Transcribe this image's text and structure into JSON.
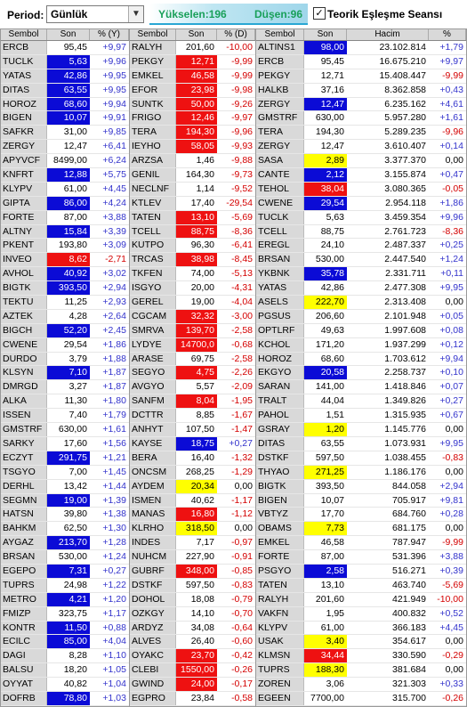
{
  "toolbar": {
    "period_label": "Period:",
    "period_value": "Günlük",
    "advancers": "Yükselen:196",
    "decliners": "Düşen:96",
    "theoretical_label": "Teorik Eşleşme Seansı",
    "theoretical_checked": true
  },
  "colors": {
    "highlight_blue": "#0b0bd6",
    "highlight_red": "#ee1111",
    "highlight_yellow": "#ffff00",
    "positive": "#3333cc",
    "negative": "#d40000"
  },
  "panel1": {
    "headers": [
      "Sembol",
      "Son",
      "% (Y)"
    ],
    "rows": [
      [
        "ERCB",
        "95,45",
        "+9,97",
        ""
      ],
      [
        "TUCLK",
        "5,63",
        "+9,96",
        "blue"
      ],
      [
        "YATAS",
        "42,86",
        "+9,95",
        "blue"
      ],
      [
        "DITAS",
        "63,55",
        "+9,95",
        "blue"
      ],
      [
        "HOROZ",
        "68,60",
        "+9,94",
        "blue"
      ],
      [
        "BIGEN",
        "10,07",
        "+9,91",
        "blue"
      ],
      [
        "SAFKR",
        "31,00",
        "+9,85",
        ""
      ],
      [
        "ZERGY",
        "12,47",
        "+6,41",
        ""
      ],
      [
        "APYVCF",
        "8499,00",
        "+6,24",
        ""
      ],
      [
        "KNFRT",
        "12,88",
        "+5,75",
        "blue"
      ],
      [
        "KLYPV",
        "61,00",
        "+4,45",
        ""
      ],
      [
        "GIPTA",
        "86,00",
        "+4,24",
        "blue"
      ],
      [
        "FORTE",
        "87,00",
        "+3,88",
        ""
      ],
      [
        "ALTNY",
        "15,84",
        "+3,39",
        "blue"
      ],
      [
        "PKENT",
        "193,80",
        "+3,09",
        ""
      ],
      [
        "INVEO",
        "8,62",
        "-2,71",
        "red"
      ],
      [
        "AVHOL",
        "40,92",
        "+3,02",
        "blue"
      ],
      [
        "BIGTK",
        "393,50",
        "+2,94",
        "blue"
      ],
      [
        "TEKTU",
        "11,25",
        "+2,93",
        ""
      ],
      [
        "AZTEK",
        "4,28",
        "+2,64",
        ""
      ],
      [
        "BIGCH",
        "52,20",
        "+2,45",
        "blue"
      ],
      [
        "CWENE",
        "29,54",
        "+1,86",
        ""
      ],
      [
        "DURDO",
        "3,79",
        "+1,88",
        ""
      ],
      [
        "KLSYN",
        "7,10",
        "+1,87",
        "blue"
      ],
      [
        "DMRGD",
        "3,27",
        "+1,87",
        ""
      ],
      [
        "ALKA",
        "11,30",
        "+1,80",
        ""
      ],
      [
        "ISSEN",
        "7,40",
        "+1,79",
        ""
      ],
      [
        "GMSTRF",
        "630,00",
        "+1,61",
        ""
      ],
      [
        "SARKY",
        "17,60",
        "+1,56",
        ""
      ],
      [
        "ECZYT",
        "291,75",
        "+1,21",
        "blue"
      ],
      [
        "TSGYO",
        "7,00",
        "+1,45",
        ""
      ],
      [
        "DERHL",
        "13,42",
        "+1,44",
        ""
      ],
      [
        "SEGMN",
        "19,00",
        "+1,39",
        "blue"
      ],
      [
        "HATSN",
        "39,80",
        "+1,38",
        ""
      ],
      [
        "BAHKM",
        "62,50",
        "+1,30",
        ""
      ],
      [
        "AYGAZ",
        "213,70",
        "+1,28",
        "blue"
      ],
      [
        "BRSAN",
        "530,00",
        "+1,24",
        ""
      ],
      [
        "EGEPO",
        "7,31",
        "+0,27",
        "blue"
      ],
      [
        "TUPRS",
        "24,98",
        "+1,22",
        ""
      ],
      [
        "METRO",
        "4,21",
        "+1,20",
        "blue"
      ],
      [
        "FMIZP",
        "323,75",
        "+1,17",
        ""
      ],
      [
        "KONTR",
        "11,50",
        "+0,88",
        "blue"
      ],
      [
        "ECILC",
        "85,00",
        "+4,04",
        "blue"
      ],
      [
        "DAGI",
        "8,28",
        "+1,10",
        ""
      ],
      [
        "BALSU",
        "18,20",
        "+1,05",
        ""
      ],
      [
        "OYYAT",
        "40,82",
        "+1,04",
        ""
      ],
      [
        "DOFRB",
        "78,80",
        "+1,03",
        "blue"
      ]
    ]
  },
  "panel2": {
    "headers": [
      "Sembol",
      "Son",
      "% (D)"
    ],
    "rows": [
      [
        "RALYH",
        "201,60",
        "-10,00",
        ""
      ],
      [
        "PEKGY",
        "12,71",
        "-9,99",
        "red"
      ],
      [
        "EMKEL",
        "46,58",
        "-9,99",
        "red"
      ],
      [
        "EFOR",
        "23,98",
        "-9,98",
        "red"
      ],
      [
        "SUNTK",
        "50,00",
        "-9,26",
        "red"
      ],
      [
        "FRIGO",
        "12,46",
        "-9,97",
        "red"
      ],
      [
        "TERA",
        "194,30",
        "-9,96",
        "red"
      ],
      [
        "IEYHO",
        "58,05",
        "-9,93",
        "red"
      ],
      [
        "ARZSA",
        "1,46",
        "-9,88",
        ""
      ],
      [
        "GENIL",
        "164,30",
        "-9,73",
        ""
      ],
      [
        "NECLNF",
        "1,14",
        "-9,52",
        ""
      ],
      [
        "KTLEV",
        "17,40",
        "-29,54",
        ""
      ],
      [
        "TATEN",
        "13,10",
        "-5,69",
        "red"
      ],
      [
        "TCELL",
        "88,75",
        "-8,36",
        "red"
      ],
      [
        "KUTPO",
        "96,30",
        "-6,41",
        ""
      ],
      [
        "TRCAS",
        "38,98",
        "-8,45",
        "red"
      ],
      [
        "TKFEN",
        "74,00",
        "-5,13",
        ""
      ],
      [
        "ISGYO",
        "20,00",
        "-4,31",
        ""
      ],
      [
        "GEREL",
        "19,00",
        "-4,04",
        ""
      ],
      [
        "CGCAM",
        "32,32",
        "-3,00",
        "red"
      ],
      [
        "SMRVA",
        "139,70",
        "-2,58",
        "red"
      ],
      [
        "LYDYE",
        "14700,0",
        "-0,68",
        "red"
      ],
      [
        "ARASE",
        "69,75",
        "-2,58",
        ""
      ],
      [
        "SEGYO",
        "4,75",
        "-2,26",
        "red"
      ],
      [
        "AVGYO",
        "5,57",
        "-2,09",
        ""
      ],
      [
        "SANFM",
        "8,04",
        "-1,95",
        "red"
      ],
      [
        "DCTTR",
        "8,85",
        "-1,67",
        ""
      ],
      [
        "ANHYT",
        "107,50",
        "-1,47",
        ""
      ],
      [
        "KAYSE",
        "18,75",
        "+0,27",
        "blue"
      ],
      [
        "BERA",
        "16,40",
        "-1,32",
        ""
      ],
      [
        "ONCSM",
        "268,25",
        "-1,29",
        ""
      ],
      [
        "AYDEM",
        "20,34",
        "0,00",
        "yellow"
      ],
      [
        "ISMEN",
        "40,62",
        "-1,17",
        ""
      ],
      [
        "MANAS",
        "16,80",
        "-1,12",
        "red"
      ],
      [
        "KLRHO",
        "318,50",
        "0,00",
        "yellow"
      ],
      [
        "INDES",
        "7,17",
        "-0,97",
        ""
      ],
      [
        "NUHCM",
        "227,90",
        "-0,91",
        ""
      ],
      [
        "GUBRF",
        "348,00",
        "-0,85",
        "red"
      ],
      [
        "DSTKF",
        "597,50",
        "-0,83",
        ""
      ],
      [
        "DOHOL",
        "18,08",
        "-0,79",
        ""
      ],
      [
        "OZKGY",
        "14,10",
        "-0,70",
        ""
      ],
      [
        "ARDYZ",
        "34,08",
        "-0,64",
        ""
      ],
      [
        "ALVES",
        "26,40",
        "-0,60",
        ""
      ],
      [
        "OYAKC",
        "23,70",
        "-0,42",
        "red"
      ],
      [
        "CLEBI",
        "1550,00",
        "-0,26",
        "red"
      ],
      [
        "GWIND",
        "24,00",
        "-0,17",
        "red"
      ],
      [
        "EGPRO",
        "23,84",
        "-0,58",
        ""
      ]
    ]
  },
  "panel3": {
    "headers": [
      "Sembol",
      "Son",
      "Hacim",
      "%"
    ],
    "rows": [
      [
        "ALTINS1",
        "98,00",
        "23.102.814",
        "+1,79",
        "blue"
      ],
      [
        "ERCB",
        "95,45",
        "16.675.210",
        "+9,97",
        ""
      ],
      [
        "PEKGY",
        "12,71",
        "15.408.447",
        "-9,99",
        ""
      ],
      [
        "HALKB",
        "37,16",
        "8.362.858",
        "+0,43",
        ""
      ],
      [
        "ZERGY",
        "12,47",
        "6.235.162",
        "+4,61",
        "blue"
      ],
      [
        "GMSTRF",
        "630,00",
        "5.957.280",
        "+1,61",
        ""
      ],
      [
        "TERA",
        "194,30",
        "5.289.235",
        "-9,96",
        ""
      ],
      [
        "ZERGY",
        "12,47",
        "3.610.407",
        "+0,14",
        ""
      ],
      [
        "SASA",
        "2,89",
        "3.377.370",
        "0,00",
        "yellow"
      ],
      [
        "CANTE",
        "2,12",
        "3.155.874",
        "+0,47",
        "blue"
      ],
      [
        "TEHOL",
        "38,04",
        "3.080.365",
        "-0,05",
        "red"
      ],
      [
        "CWENE",
        "29,54",
        "2.954.118",
        "+1,86",
        "blue"
      ],
      [
        "TUCLK",
        "5,63",
        "3.459.354",
        "+9,96",
        ""
      ],
      [
        "TCELL",
        "88,75",
        "2.761.723",
        "-8,36",
        ""
      ],
      [
        "EREGL",
        "24,10",
        "2.487.337",
        "+0,25",
        ""
      ],
      [
        "BRSAN",
        "530,00",
        "2.447.540",
        "+1,24",
        ""
      ],
      [
        "YKBNK",
        "35,78",
        "2.331.711",
        "+0,11",
        "blue"
      ],
      [
        "YATAS",
        "42,86",
        "2.477.308",
        "+9,95",
        ""
      ],
      [
        "ASELS",
        "222,70",
        "2.313.408",
        "0,00",
        "yellow"
      ],
      [
        "PGSUS",
        "206,60",
        "2.101.948",
        "+0,05",
        ""
      ],
      [
        "OPTLRF",
        "49,63",
        "1.997.608",
        "+0,08",
        ""
      ],
      [
        "KCHOL",
        "171,20",
        "1.937.299",
        "+0,12",
        ""
      ],
      [
        "HOROZ",
        "68,60",
        "1.703.612",
        "+9,94",
        ""
      ],
      [
        "EKGYO",
        "20,58",
        "2.258.737",
        "+0,10",
        "blue"
      ],
      [
        "SARAN",
        "141,00",
        "1.418.846",
        "+0,07",
        ""
      ],
      [
        "TRALT",
        "44,04",
        "1.349.826",
        "+0,27",
        ""
      ],
      [
        "PAHOL",
        "1,51",
        "1.315.935",
        "+0,67",
        ""
      ],
      [
        "GSRAY",
        "1,20",
        "1.145.776",
        "0,00",
        "yellow"
      ],
      [
        "DITAS",
        "63,55",
        "1.073.931",
        "+9,95",
        ""
      ],
      [
        "DSTKF",
        "597,50",
        "1.038.455",
        "-0,83",
        ""
      ],
      [
        "THYAO",
        "271,25",
        "1.186.176",
        "0,00",
        "yellow"
      ],
      [
        "BIGTK",
        "393,50",
        "844.058",
        "+2,94",
        ""
      ],
      [
        "BIGEN",
        "10,07",
        "705.917",
        "+9,81",
        ""
      ],
      [
        "VBTYZ",
        "17,70",
        "684.760",
        "+0,28",
        ""
      ],
      [
        "OBAMS",
        "7,73",
        "681.175",
        "0,00",
        "yellow"
      ],
      [
        "EMKEL",
        "46,58",
        "787.947",
        "-9,99",
        ""
      ],
      [
        "FORTE",
        "87,00",
        "531.396",
        "+3,88",
        ""
      ],
      [
        "PSGYO",
        "2,58",
        "516.271",
        "+0,39",
        "blue"
      ],
      [
        "TATEN",
        "13,10",
        "463.740",
        "-5,69",
        ""
      ],
      [
        "RALYH",
        "201,60",
        "421.949",
        "-10,00",
        ""
      ],
      [
        "VAKFN",
        "1,95",
        "400.832",
        "+0,52",
        ""
      ],
      [
        "KLYPV",
        "61,00",
        "366.183",
        "+4,45",
        ""
      ],
      [
        "USAK",
        "3,40",
        "354.617",
        "0,00",
        "yellow"
      ],
      [
        "KLMSN",
        "34,44",
        "330.590",
        "-0,29",
        "red"
      ],
      [
        "TUPRS",
        "188,30",
        "381.684",
        "0,00",
        "yellow"
      ],
      [
        "ZOREN",
        "3,06",
        "321.303",
        "+0,33",
        ""
      ],
      [
        "EGEEN",
        "7700,00",
        "315.700",
        "-0,26",
        ""
      ]
    ]
  }
}
